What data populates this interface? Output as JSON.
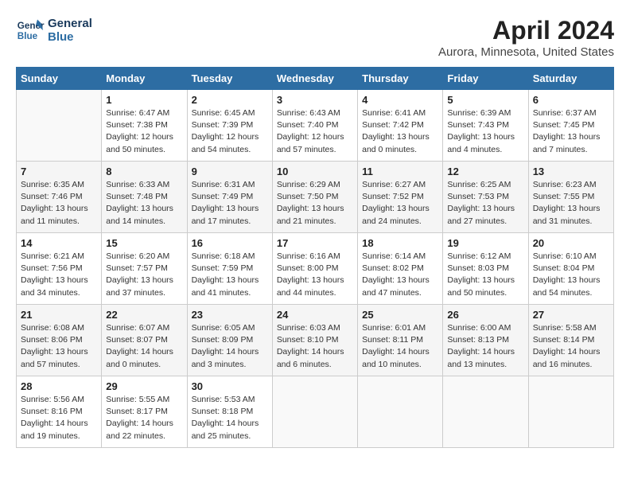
{
  "header": {
    "logo_line1": "General",
    "logo_line2": "Blue",
    "title": "April 2024",
    "subtitle": "Aurora, Minnesota, United States"
  },
  "weekdays": [
    "Sunday",
    "Monday",
    "Tuesday",
    "Wednesday",
    "Thursday",
    "Friday",
    "Saturday"
  ],
  "weeks": [
    [
      {
        "day": "",
        "info": ""
      },
      {
        "day": "1",
        "info": "Sunrise: 6:47 AM\nSunset: 7:38 PM\nDaylight: 12 hours\nand 50 minutes."
      },
      {
        "day": "2",
        "info": "Sunrise: 6:45 AM\nSunset: 7:39 PM\nDaylight: 12 hours\nand 54 minutes."
      },
      {
        "day": "3",
        "info": "Sunrise: 6:43 AM\nSunset: 7:40 PM\nDaylight: 12 hours\nand 57 minutes."
      },
      {
        "day": "4",
        "info": "Sunrise: 6:41 AM\nSunset: 7:42 PM\nDaylight: 13 hours\nand 0 minutes."
      },
      {
        "day": "5",
        "info": "Sunrise: 6:39 AM\nSunset: 7:43 PM\nDaylight: 13 hours\nand 4 minutes."
      },
      {
        "day": "6",
        "info": "Sunrise: 6:37 AM\nSunset: 7:45 PM\nDaylight: 13 hours\nand 7 minutes."
      }
    ],
    [
      {
        "day": "7",
        "info": "Sunrise: 6:35 AM\nSunset: 7:46 PM\nDaylight: 13 hours\nand 11 minutes."
      },
      {
        "day": "8",
        "info": "Sunrise: 6:33 AM\nSunset: 7:48 PM\nDaylight: 13 hours\nand 14 minutes."
      },
      {
        "day": "9",
        "info": "Sunrise: 6:31 AM\nSunset: 7:49 PM\nDaylight: 13 hours\nand 17 minutes."
      },
      {
        "day": "10",
        "info": "Sunrise: 6:29 AM\nSunset: 7:50 PM\nDaylight: 13 hours\nand 21 minutes."
      },
      {
        "day": "11",
        "info": "Sunrise: 6:27 AM\nSunset: 7:52 PM\nDaylight: 13 hours\nand 24 minutes."
      },
      {
        "day": "12",
        "info": "Sunrise: 6:25 AM\nSunset: 7:53 PM\nDaylight: 13 hours\nand 27 minutes."
      },
      {
        "day": "13",
        "info": "Sunrise: 6:23 AM\nSunset: 7:55 PM\nDaylight: 13 hours\nand 31 minutes."
      }
    ],
    [
      {
        "day": "14",
        "info": "Sunrise: 6:21 AM\nSunset: 7:56 PM\nDaylight: 13 hours\nand 34 minutes."
      },
      {
        "day": "15",
        "info": "Sunrise: 6:20 AM\nSunset: 7:57 PM\nDaylight: 13 hours\nand 37 minutes."
      },
      {
        "day": "16",
        "info": "Sunrise: 6:18 AM\nSunset: 7:59 PM\nDaylight: 13 hours\nand 41 minutes."
      },
      {
        "day": "17",
        "info": "Sunrise: 6:16 AM\nSunset: 8:00 PM\nDaylight: 13 hours\nand 44 minutes."
      },
      {
        "day": "18",
        "info": "Sunrise: 6:14 AM\nSunset: 8:02 PM\nDaylight: 13 hours\nand 47 minutes."
      },
      {
        "day": "19",
        "info": "Sunrise: 6:12 AM\nSunset: 8:03 PM\nDaylight: 13 hours\nand 50 minutes."
      },
      {
        "day": "20",
        "info": "Sunrise: 6:10 AM\nSunset: 8:04 PM\nDaylight: 13 hours\nand 54 minutes."
      }
    ],
    [
      {
        "day": "21",
        "info": "Sunrise: 6:08 AM\nSunset: 8:06 PM\nDaylight: 13 hours\nand 57 minutes."
      },
      {
        "day": "22",
        "info": "Sunrise: 6:07 AM\nSunset: 8:07 PM\nDaylight: 14 hours\nand 0 minutes."
      },
      {
        "day": "23",
        "info": "Sunrise: 6:05 AM\nSunset: 8:09 PM\nDaylight: 14 hours\nand 3 minutes."
      },
      {
        "day": "24",
        "info": "Sunrise: 6:03 AM\nSunset: 8:10 PM\nDaylight: 14 hours\nand 6 minutes."
      },
      {
        "day": "25",
        "info": "Sunrise: 6:01 AM\nSunset: 8:11 PM\nDaylight: 14 hours\nand 10 minutes."
      },
      {
        "day": "26",
        "info": "Sunrise: 6:00 AM\nSunset: 8:13 PM\nDaylight: 14 hours\nand 13 minutes."
      },
      {
        "day": "27",
        "info": "Sunrise: 5:58 AM\nSunset: 8:14 PM\nDaylight: 14 hours\nand 16 minutes."
      }
    ],
    [
      {
        "day": "28",
        "info": "Sunrise: 5:56 AM\nSunset: 8:16 PM\nDaylight: 14 hours\nand 19 minutes."
      },
      {
        "day": "29",
        "info": "Sunrise: 5:55 AM\nSunset: 8:17 PM\nDaylight: 14 hours\nand 22 minutes."
      },
      {
        "day": "30",
        "info": "Sunrise: 5:53 AM\nSunset: 8:18 PM\nDaylight: 14 hours\nand 25 minutes."
      },
      {
        "day": "",
        "info": ""
      },
      {
        "day": "",
        "info": ""
      },
      {
        "day": "",
        "info": ""
      },
      {
        "day": "",
        "info": ""
      }
    ]
  ]
}
